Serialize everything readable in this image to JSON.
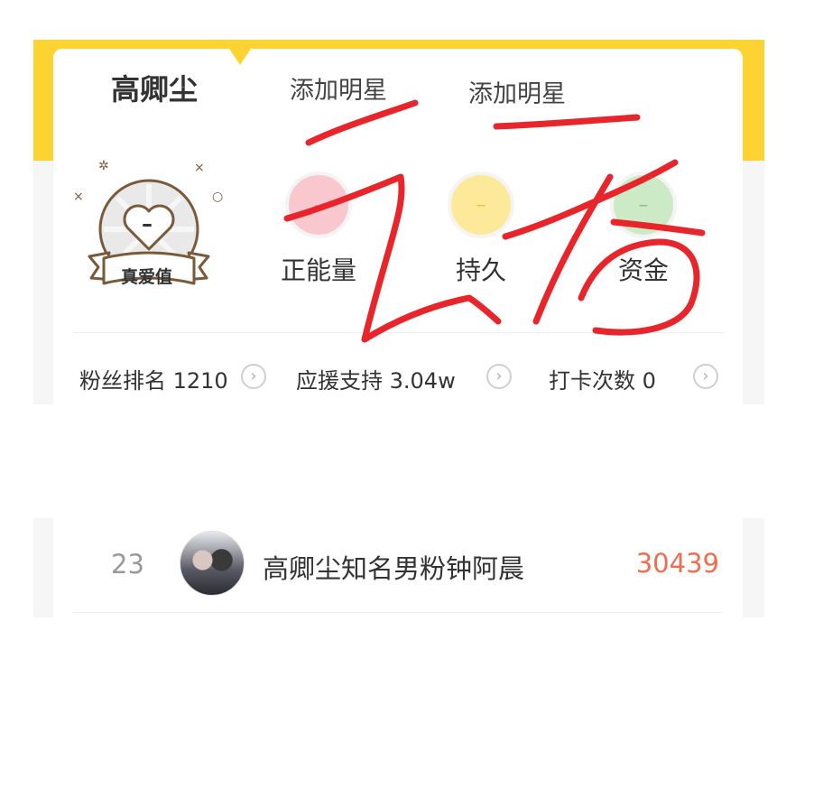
{
  "tabs": [
    {
      "label": "高卿尘",
      "active": true
    },
    {
      "label": "添加明星",
      "active": false
    },
    {
      "label": "添加明星",
      "active": false
    }
  ],
  "badge": {
    "value": "–",
    "label": "真爱值",
    "icon": "heart-badge-icon"
  },
  "stats": [
    {
      "value": "–",
      "label": "正能量",
      "color": "#f9c8cf"
    },
    {
      "value": "–",
      "label": "持久",
      "color": "#fde99a"
    },
    {
      "value": "–",
      "label": "资金",
      "color": "#cdeac6"
    }
  ],
  "summary": [
    {
      "label": "粉丝排名 1210"
    },
    {
      "label": "应援支持 3.04w"
    },
    {
      "label": "打卡次数 0"
    }
  ],
  "fan_row": {
    "rank": "23",
    "name": "高卿尘知名男粉钟阿晨",
    "score": "30439"
  },
  "colors": {
    "accent": "#fdd332",
    "score": "#f26d4f",
    "scribble": "#e8252a"
  }
}
